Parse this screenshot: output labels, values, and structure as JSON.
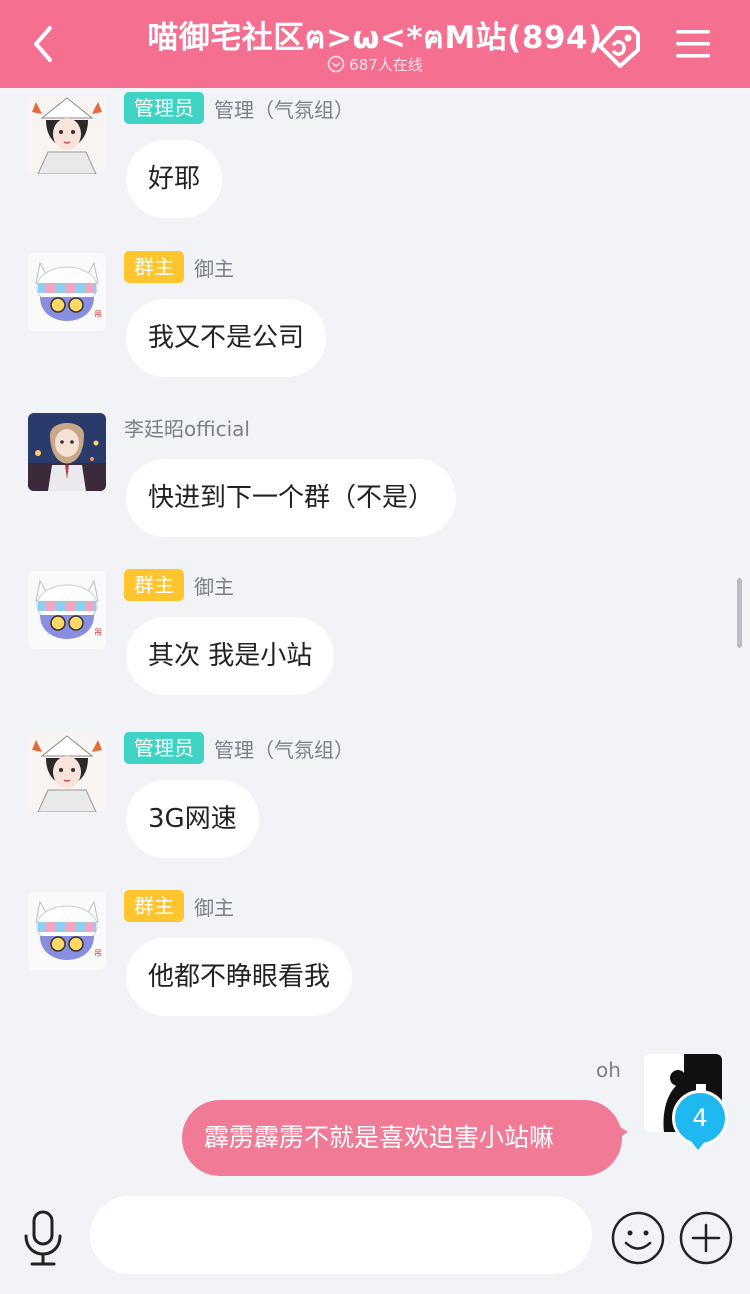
{
  "header": {
    "title": "喵御宅社区ฅ>ω<*ฅM站(894)",
    "online": "687人在线",
    "colors": {
      "bar": "#f56f91",
      "text": "#ffffff"
    }
  },
  "messages": [
    {
      "avatar": "white-hair-girl",
      "badge": "管理员",
      "badge_type": "admin",
      "name": "管理（气氛组）",
      "text": "好耶"
    },
    {
      "avatar": "cat-mascot",
      "badge": "群主",
      "badge_type": "owner",
      "name": "御主",
      "text": "我又不是公司"
    },
    {
      "avatar": "uniform-girl",
      "badge": "",
      "badge_type": "none",
      "name": "李廷昭official",
      "text": "快进到下一个群（不是）"
    },
    {
      "avatar": "cat-mascot",
      "badge": "群主",
      "badge_type": "owner",
      "name": "御主",
      "text": "其次 我是小站"
    },
    {
      "avatar": "white-hair-girl",
      "badge": "管理员",
      "badge_type": "admin",
      "name": "管理（气氛组）",
      "text": "3G网速"
    },
    {
      "avatar": "cat-mascot",
      "badge": "群主",
      "badge_type": "owner",
      "name": "御主",
      "text": "他都不睁眼看我"
    }
  ],
  "my_message": {
    "name": "oh",
    "text": "霹雳霹雳不就是喜欢迫害小站嘛",
    "bubble_color": "#f17b97"
  },
  "unread_count": "4",
  "input": {
    "placeholder": "",
    "value": ""
  },
  "icons": {
    "back": "chevron-left-icon",
    "share": "share-icon",
    "menu": "menu-icon",
    "mic": "mic-icon",
    "emoji": "emoji-icon",
    "plus": "plus-icon"
  },
  "colors": {
    "admin_badge": "#3fd3c4",
    "owner_badge": "#ffc52f",
    "background": "#f1f3f7",
    "unread": "#1fb8f1"
  }
}
